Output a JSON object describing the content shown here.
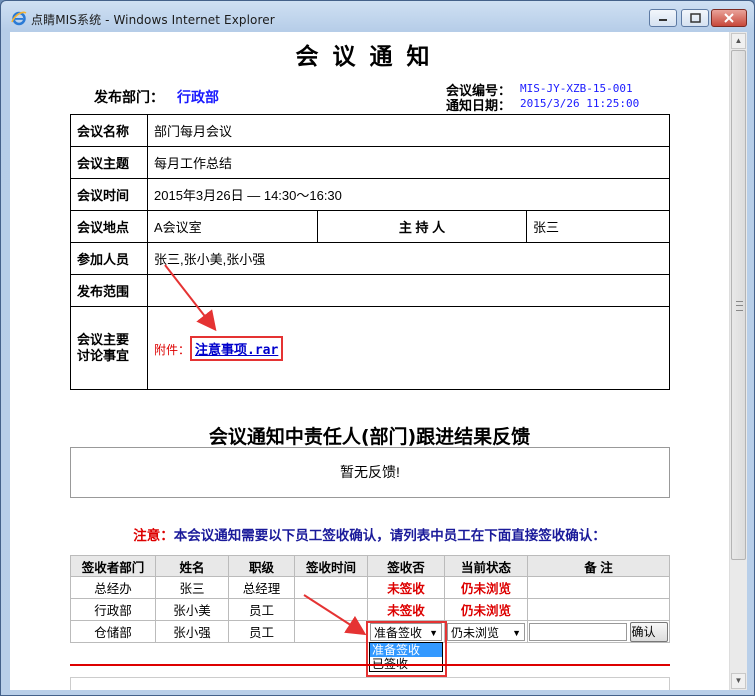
{
  "window": {
    "title": "点睛MIS系统 - Windows Internet Explorer"
  },
  "page": {
    "title": "会议通知",
    "dept_label": "发布部门：",
    "dept_value": "行政部",
    "meeting_no_label": "会议编号：",
    "meeting_no_value": "MIS-JY-XZB-15-001",
    "notice_date_label": "通知日期：",
    "notice_date_value": "2015/3/26 11:25:00"
  },
  "info": {
    "name_label": "会议名称",
    "name_value": "部门每月会议",
    "topic_label": "会议主题",
    "topic_value": "每月工作总结",
    "time_label": "会议时间",
    "time_value": "2015年3月26日 — 14:30～16:30",
    "place_label": "会议地点",
    "place_value": "A会议室",
    "host_label": "主 持 人",
    "host_value": "张三",
    "attendees_label": "参加人员",
    "attendees_value": "张三,张小美,张小强",
    "scope_label": "发布范围",
    "scope_value": "",
    "matters_label": "会议主要讨论事宜",
    "attachment_prefix": "附件：",
    "attachment_link": "注意事项.rar"
  },
  "feedback": {
    "title": "会议通知中责任人(部门)跟进结果反馈",
    "empty_text": "暂无反馈!"
  },
  "notice": {
    "prefix": "注意：",
    "text": "本会议通知需要以下员工签收确认，请列表中员工在下面直接签收确认："
  },
  "sign_table": {
    "headers": [
      "签收者部门",
      "姓名",
      "职级",
      "签收时间",
      "签收否",
      "当前状态",
      "备  注"
    ],
    "rows": [
      {
        "dept": "总经办",
        "name": "张三",
        "rank": "总经理",
        "time": "",
        "signed": "未签收",
        "status": "仍未浏览",
        "note": ""
      },
      {
        "dept": "行政部",
        "name": "张小美",
        "rank": "员工",
        "time": "",
        "signed": "未签收",
        "status": "仍未浏览",
        "note": ""
      }
    ],
    "editable_row": {
      "dept": "仓储部",
      "name": "张小强",
      "rank": "员工",
      "time": "",
      "sign_select": "准备签收",
      "status_select": "仍未浏览",
      "confirm_label": "确认"
    },
    "dropdown_options": [
      "准备签收",
      "已签收"
    ]
  },
  "colors": {
    "accent_blue": "#1a1aff",
    "alert_red": "#dd0000",
    "highlight_red": "#e53333"
  }
}
